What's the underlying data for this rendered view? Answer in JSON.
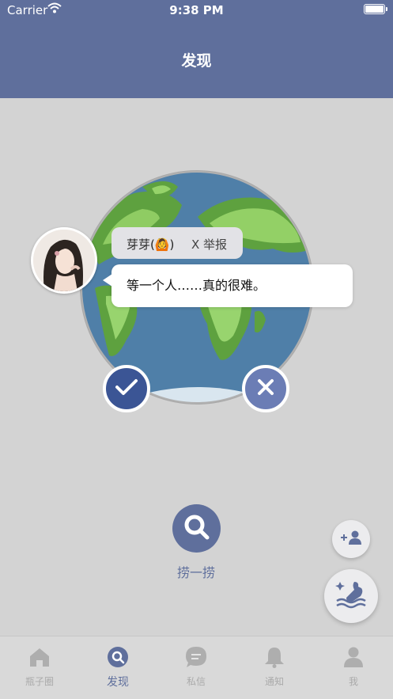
{
  "status_bar": {
    "carrier": "Carrier",
    "time": "9:38 PM"
  },
  "nav": {
    "title": "发现"
  },
  "card": {
    "username": "芽芽(🙆)",
    "report_label": "X 举报",
    "message": "等一个人……真的很难。"
  },
  "actions": {
    "accept_icon": "checkmark-icon",
    "reject_icon": "close-icon"
  },
  "fish": {
    "label": "捞一捞",
    "icon": "search-icon"
  },
  "floating": {
    "add_friend_icon": "add-user-icon",
    "throw_icon": "throw-bottle-icon"
  },
  "tabs": [
    {
      "label": "瓶子圈",
      "icon": "home-icon",
      "active": false
    },
    {
      "label": "发现",
      "icon": "discover-icon",
      "active": true
    },
    {
      "label": "私信",
      "icon": "chat-bubble-icon",
      "active": false
    },
    {
      "label": "通知",
      "icon": "bell-icon",
      "active": false
    },
    {
      "label": "我",
      "icon": "person-icon",
      "active": false
    }
  ],
  "colors": {
    "brand": "#5f6f9c",
    "accept": "#3b5595",
    "reject": "#6b7db5",
    "background": "#d3d3d3"
  }
}
